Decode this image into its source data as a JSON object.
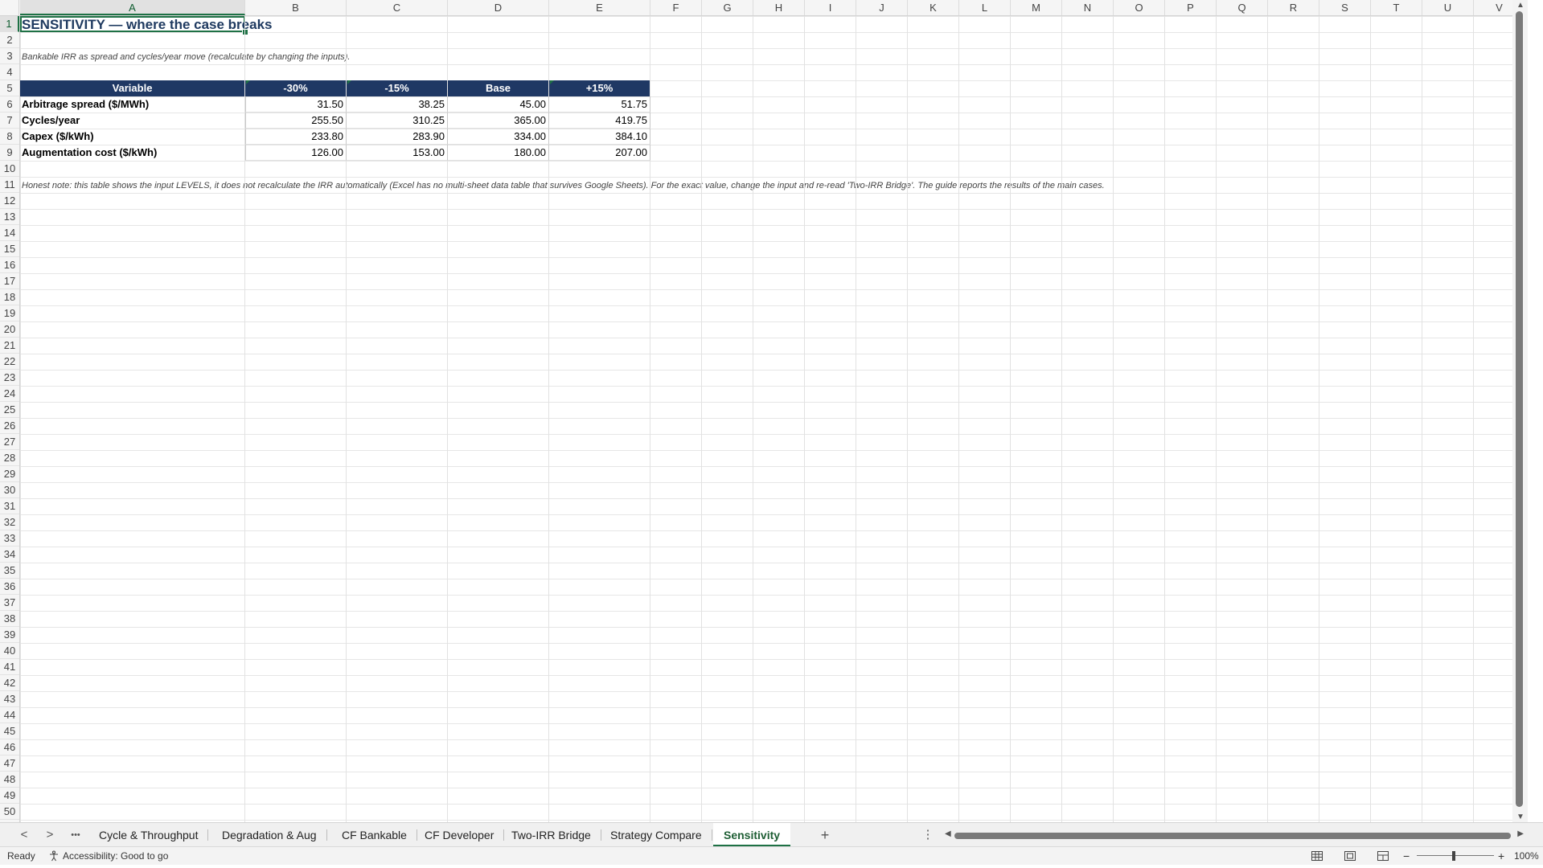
{
  "columns": [
    "A",
    "B",
    "C",
    "D",
    "E",
    "F",
    "G",
    "H",
    "I",
    "J",
    "K",
    "L",
    "M",
    "N",
    "O",
    "P",
    "Q",
    "R",
    "S",
    "T",
    "U",
    "V"
  ],
  "rows": [
    "1",
    "2",
    "3",
    "4",
    "5",
    "6",
    "7",
    "8",
    "9",
    "10",
    "11",
    "12",
    "13",
    "14",
    "15",
    "16",
    "17",
    "18",
    "19",
    "20",
    "21",
    "22",
    "23",
    "24",
    "25",
    "26",
    "27",
    "28",
    "29",
    "30",
    "31",
    "32",
    "33",
    "34",
    "35",
    "36",
    "37",
    "38",
    "39",
    "40",
    "41",
    "42",
    "43",
    "44",
    "45",
    "46",
    "47",
    "48",
    "49",
    "50"
  ],
  "sheet": {
    "title": "SENSITIVITY — where the case breaks",
    "subtitle": "Bankable IRR as spread and cycles/year move (recalculate by changing the inputs).",
    "table": {
      "headers": [
        "Variable",
        "-30%",
        "-15%",
        "Base",
        "+15%"
      ],
      "rows": [
        {
          "label": "Arbitrage spread ($/MWh)",
          "values": [
            "31.50",
            "38.25",
            "45.00",
            "51.75"
          ]
        },
        {
          "label": "Cycles/year",
          "values": [
            "255.50",
            "310.25",
            "365.00",
            "419.75"
          ]
        },
        {
          "label": "Capex ($/kWh)",
          "values": [
            "233.80",
            "283.90",
            "334.00",
            "384.10"
          ]
        },
        {
          "label": "Augmentation cost ($/kWh)",
          "values": [
            "126.00",
            "153.00",
            "180.00",
            "207.00"
          ]
        }
      ]
    },
    "note": "Honest note: this table shows the input LEVELS, it does not recalculate the IRR automatically (Excel has no multi-sheet data table that survives Google Sheets). For the exact value, change the input and re-read 'Two-IRR Bridge'. The guide reports the results of the main cases."
  },
  "tabs": {
    "prev": "<",
    "next": ">",
    "more": "•••",
    "items": [
      "Cycle & Throughput",
      "Degradation & Aug",
      "CF Bankable",
      "CF Developer",
      "Two-IRR Bridge",
      "Strategy Compare",
      "Sensitivity"
    ],
    "active": "Sensitivity",
    "add": "+",
    "options": "⋮"
  },
  "status": {
    "ready": "Ready",
    "accessibility": "Accessibility: Good to go",
    "zoom_minus": "−",
    "zoom_plus": "+",
    "zoom": "100%"
  },
  "icons": {
    "accessibility": "accessibility-icon",
    "normal_view": "normal-view-icon",
    "page_layout": "page-layout-icon",
    "page_break": "page-break-icon"
  },
  "colors": {
    "header_fill": "#1f3864",
    "title": "#1f3a60",
    "accent": "#1e7145"
  }
}
